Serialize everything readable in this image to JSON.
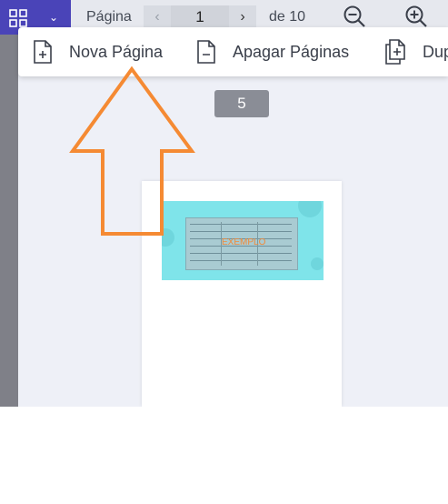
{
  "toolbar": {
    "page_label": "Página",
    "prev_icon": "chevron-left-icon",
    "current_page": "1",
    "next_icon": "chevron-right-icon",
    "of_label": "de 10",
    "zoom_out_icon": "zoom-out-icon",
    "zoom_in_icon": "zoom-in-icon",
    "menu_icon": "grid-icon",
    "accent_color": "#4a44b8"
  },
  "page_menu": {
    "items": [
      {
        "label": "Nova Página",
        "icon": "file-plus-icon"
      },
      {
        "label": "Apagar Páginas",
        "icon": "file-minus-icon"
      },
      {
        "label": "Dup",
        "icon": "file-duplicate-icon"
      }
    ]
  },
  "viewer": {
    "page_number": "5",
    "thumbnail_stamp": "EXEMPLO"
  },
  "annotation": {
    "color": "#f58a33"
  }
}
